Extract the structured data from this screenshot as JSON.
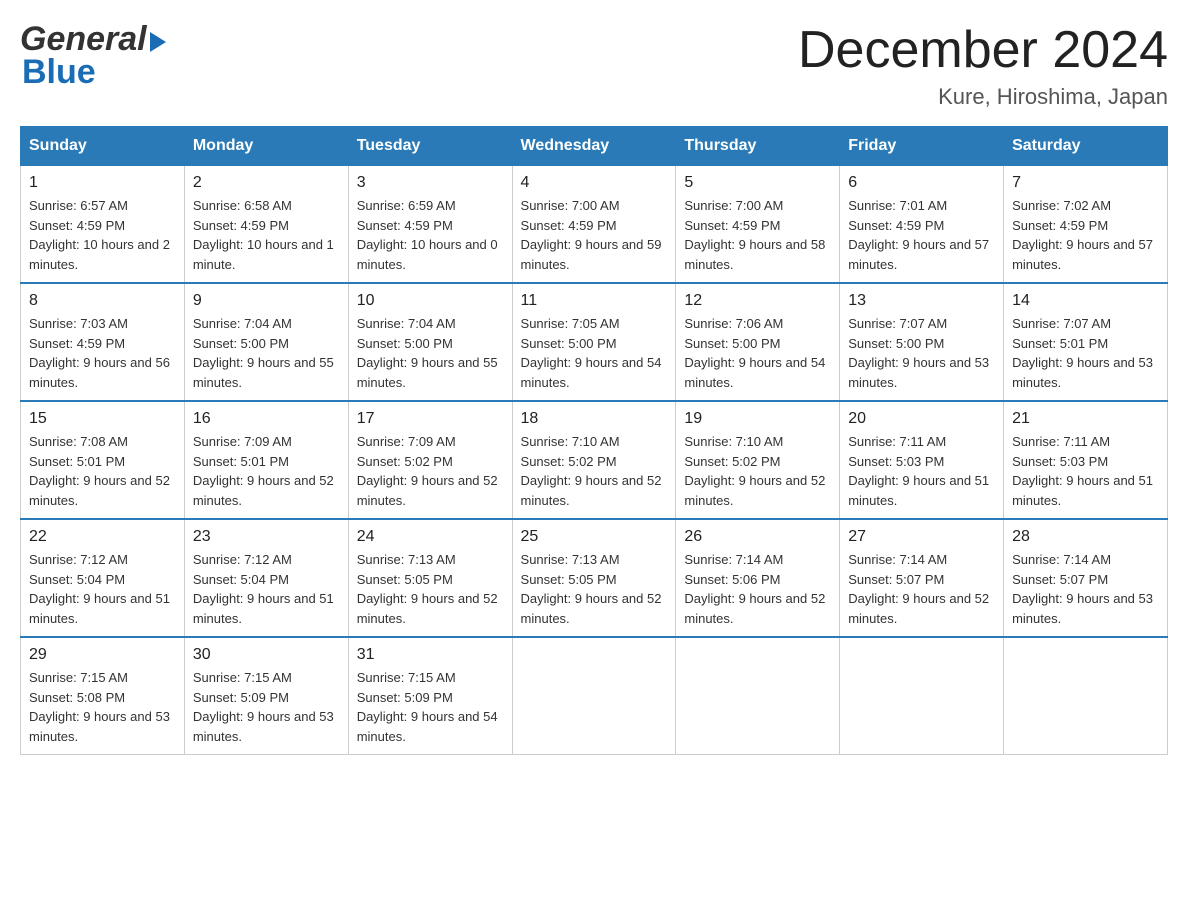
{
  "logo": {
    "general": "General",
    "blue": "Blue",
    "arrow": "▶"
  },
  "title": "December 2024",
  "location": "Kure, Hiroshima, Japan",
  "days_of_week": [
    "Sunday",
    "Monday",
    "Tuesday",
    "Wednesday",
    "Thursday",
    "Friday",
    "Saturday"
  ],
  "weeks": [
    [
      {
        "day": "1",
        "sunrise": "6:57 AM",
        "sunset": "4:59 PM",
        "daylight": "10 hours and 2 minutes."
      },
      {
        "day": "2",
        "sunrise": "6:58 AM",
        "sunset": "4:59 PM",
        "daylight": "10 hours and 1 minute."
      },
      {
        "day": "3",
        "sunrise": "6:59 AM",
        "sunset": "4:59 PM",
        "daylight": "10 hours and 0 minutes."
      },
      {
        "day": "4",
        "sunrise": "7:00 AM",
        "sunset": "4:59 PM",
        "daylight": "9 hours and 59 minutes."
      },
      {
        "day": "5",
        "sunrise": "7:00 AM",
        "sunset": "4:59 PM",
        "daylight": "9 hours and 58 minutes."
      },
      {
        "day": "6",
        "sunrise": "7:01 AM",
        "sunset": "4:59 PM",
        "daylight": "9 hours and 57 minutes."
      },
      {
        "day": "7",
        "sunrise": "7:02 AM",
        "sunset": "4:59 PM",
        "daylight": "9 hours and 57 minutes."
      }
    ],
    [
      {
        "day": "8",
        "sunrise": "7:03 AM",
        "sunset": "4:59 PM",
        "daylight": "9 hours and 56 minutes."
      },
      {
        "day": "9",
        "sunrise": "7:04 AM",
        "sunset": "5:00 PM",
        "daylight": "9 hours and 55 minutes."
      },
      {
        "day": "10",
        "sunrise": "7:04 AM",
        "sunset": "5:00 PM",
        "daylight": "9 hours and 55 minutes."
      },
      {
        "day": "11",
        "sunrise": "7:05 AM",
        "sunset": "5:00 PM",
        "daylight": "9 hours and 54 minutes."
      },
      {
        "day": "12",
        "sunrise": "7:06 AM",
        "sunset": "5:00 PM",
        "daylight": "9 hours and 54 minutes."
      },
      {
        "day": "13",
        "sunrise": "7:07 AM",
        "sunset": "5:00 PM",
        "daylight": "9 hours and 53 minutes."
      },
      {
        "day": "14",
        "sunrise": "7:07 AM",
        "sunset": "5:01 PM",
        "daylight": "9 hours and 53 minutes."
      }
    ],
    [
      {
        "day": "15",
        "sunrise": "7:08 AM",
        "sunset": "5:01 PM",
        "daylight": "9 hours and 52 minutes."
      },
      {
        "day": "16",
        "sunrise": "7:09 AM",
        "sunset": "5:01 PM",
        "daylight": "9 hours and 52 minutes."
      },
      {
        "day": "17",
        "sunrise": "7:09 AM",
        "sunset": "5:02 PM",
        "daylight": "9 hours and 52 minutes."
      },
      {
        "day": "18",
        "sunrise": "7:10 AM",
        "sunset": "5:02 PM",
        "daylight": "9 hours and 52 minutes."
      },
      {
        "day": "19",
        "sunrise": "7:10 AM",
        "sunset": "5:02 PM",
        "daylight": "9 hours and 52 minutes."
      },
      {
        "day": "20",
        "sunrise": "7:11 AM",
        "sunset": "5:03 PM",
        "daylight": "9 hours and 51 minutes."
      },
      {
        "day": "21",
        "sunrise": "7:11 AM",
        "sunset": "5:03 PM",
        "daylight": "9 hours and 51 minutes."
      }
    ],
    [
      {
        "day": "22",
        "sunrise": "7:12 AM",
        "sunset": "5:04 PM",
        "daylight": "9 hours and 51 minutes."
      },
      {
        "day": "23",
        "sunrise": "7:12 AM",
        "sunset": "5:04 PM",
        "daylight": "9 hours and 51 minutes."
      },
      {
        "day": "24",
        "sunrise": "7:13 AM",
        "sunset": "5:05 PM",
        "daylight": "9 hours and 52 minutes."
      },
      {
        "day": "25",
        "sunrise": "7:13 AM",
        "sunset": "5:05 PM",
        "daylight": "9 hours and 52 minutes."
      },
      {
        "day": "26",
        "sunrise": "7:14 AM",
        "sunset": "5:06 PM",
        "daylight": "9 hours and 52 minutes."
      },
      {
        "day": "27",
        "sunrise": "7:14 AM",
        "sunset": "5:07 PM",
        "daylight": "9 hours and 52 minutes."
      },
      {
        "day": "28",
        "sunrise": "7:14 AM",
        "sunset": "5:07 PM",
        "daylight": "9 hours and 53 minutes."
      }
    ],
    [
      {
        "day": "29",
        "sunrise": "7:15 AM",
        "sunset": "5:08 PM",
        "daylight": "9 hours and 53 minutes."
      },
      {
        "day": "30",
        "sunrise": "7:15 AM",
        "sunset": "5:09 PM",
        "daylight": "9 hours and 53 minutes."
      },
      {
        "day": "31",
        "sunrise": "7:15 AM",
        "sunset": "5:09 PM",
        "daylight": "9 hours and 54 minutes."
      },
      null,
      null,
      null,
      null
    ]
  ]
}
